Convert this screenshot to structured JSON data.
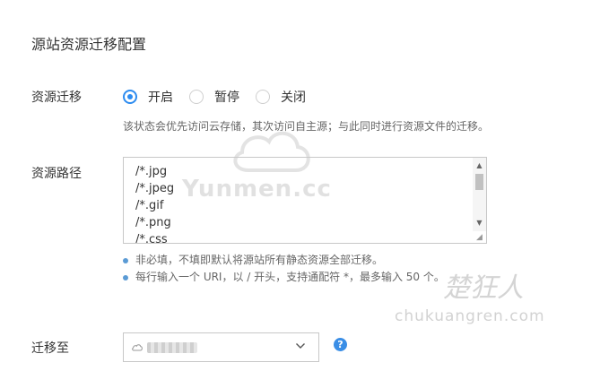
{
  "header": {
    "title": "源站资源迁移配置"
  },
  "migration": {
    "label": "资源迁移",
    "options": [
      {
        "label": "开启",
        "checked": true
      },
      {
        "label": "暂停",
        "checked": false
      },
      {
        "label": "关闭",
        "checked": false
      }
    ],
    "hint": "该状态会优先访问云存储，其次访问自主源；与此同时进行资源文件的迁移。"
  },
  "paths": {
    "label": "资源路径",
    "lines": [
      "/*.jpg",
      "/*.jpeg",
      "/*.gif",
      "/*.png",
      "/*.css"
    ],
    "notes": [
      "非必填，不填即默认将源站所有静态资源全部迁移。",
      "每行输入一个 URI，以 / 开头，支持通配符 *，最多输入 50 个。"
    ]
  },
  "target": {
    "label": "迁移至",
    "select_icon": "cloud-icon",
    "help_icon": "question-icon",
    "help_glyph": "?"
  },
  "watermark": {
    "brand": "Yunmen.cc",
    "right_logo": "楚狂人",
    "right_url": "chukuangren.com"
  },
  "colors": {
    "accent": "#2d8cf0",
    "help": "#3a8ee6",
    "bullet": "#5b9bd5"
  }
}
